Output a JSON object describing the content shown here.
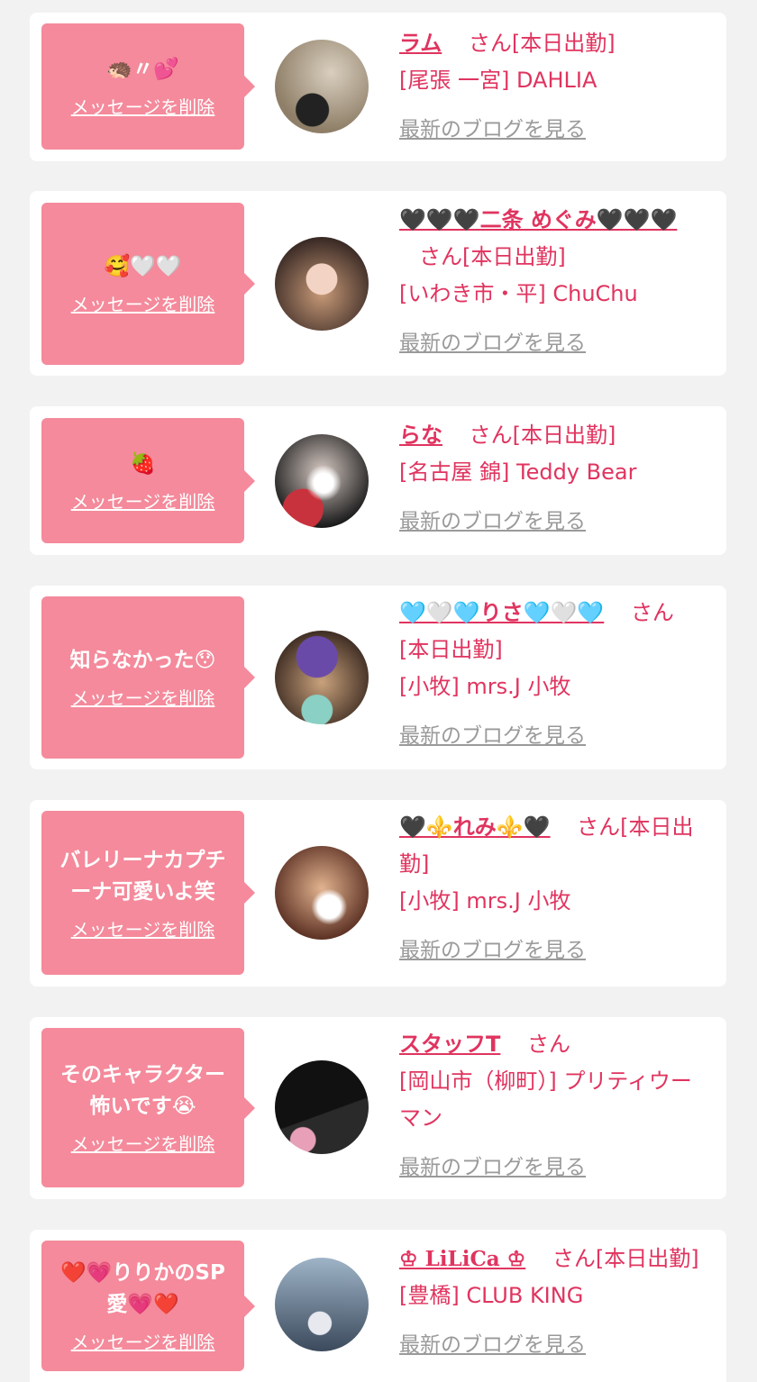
{
  "colors": {
    "background": "#f2f2f2",
    "card": "#ffffff",
    "bubble": "#f48a9b",
    "name_text": "#e0345f",
    "blog_link": "#9a9a9a"
  },
  "items": [
    {
      "message": "🦔〃💕",
      "delete_label": "メッセージを削除",
      "name": "ラム",
      "honorific": "さん",
      "status": "[本日出勤]",
      "area": "[尾張 一宮] DAHLIA",
      "blog_label": "最新のブログを見る"
    },
    {
      "message": "🥰🤍🤍",
      "delete_label": "メッセージを削除",
      "name": "🖤🖤🖤二条 めぐみ🖤🖤🖤",
      "honorific": "さん",
      "status": "[本日出勤]",
      "area": "[いわき市・平] ChuChu",
      "blog_label": "最新のブログを見る"
    },
    {
      "message": "🍓",
      "delete_label": "メッセージを削除",
      "name": "らな",
      "honorific": "さん",
      "status": "[本日出勤]",
      "area": "[名古屋 錦] Teddy Bear",
      "blog_label": "最新のブログを見る"
    },
    {
      "message": "知らなかった😯",
      "delete_label": "メッセージを削除",
      "name": "🩵🤍🩵りさ🩵🤍🩵",
      "honorific": "さん",
      "status": "[本日出勤]",
      "area": "[小牧] mrs.J 小牧",
      "blog_label": "最新のブログを見る"
    },
    {
      "message": "バレリーナカプチーナ可愛いよ笑",
      "delete_label": "メッセージを削除",
      "name": "🖤⚜️れみ⚜️🖤",
      "honorific": "さん",
      "status": "[本日出勤]",
      "area": "[小牧] mrs.J 小牧",
      "blog_label": "最新のブログを見る"
    },
    {
      "message": "そのキャラクター怖いです😭",
      "delete_label": "メッセージを削除",
      "name": "スタッフT",
      "honorific": "さん",
      "status": "",
      "area": "[岡山市（柳町）] プリティウーマン",
      "blog_label": "最新のブログを見る"
    },
    {
      "message": "❤️💗りりかのSP愛💗❤️",
      "delete_label": "メッセージを削除",
      "name": "♔ LiLiCa ♔",
      "honorific": "さん",
      "status": "[本日出勤]",
      "area": "[豊橋] CLUB KING",
      "blog_label": "最新のブログを見る"
    }
  ]
}
